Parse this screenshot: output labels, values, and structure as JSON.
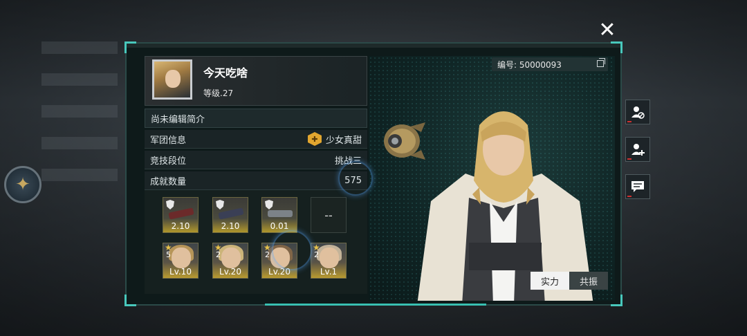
{
  "close_icon": "close-x-icon",
  "profile": {
    "name": "今天吃啥",
    "level": "等级.27"
  },
  "info_rows": [
    {
      "label": "尚未编辑简介",
      "value": ""
    },
    {
      "label": "军团信息",
      "value": "少女真甜"
    },
    {
      "label": "竞技段位",
      "value": "挑战三"
    },
    {
      "label": "成就数量",
      "value": "575"
    }
  ],
  "equipment": [
    {
      "value": "2.10",
      "icon": "shield-badge-icon"
    },
    {
      "value": "2.10",
      "icon": "rank-badge-icon"
    },
    {
      "value": "0.01",
      "icon": "shield-badge-icon"
    },
    {
      "value": "--",
      "icon": "empty-slot"
    }
  ],
  "heroes": [
    {
      "stars": "5",
      "level": "Lv.10"
    },
    {
      "stars": "2",
      "level": "Lv.20"
    },
    {
      "stars": "2",
      "level": "Lv.20"
    },
    {
      "stars": "2",
      "level": "Lv.1"
    }
  ],
  "player_id": "编号: 50000093",
  "toggle": {
    "strength_label": "实力",
    "resonance_label": "共振"
  },
  "side_buttons": [
    "block-user-icon",
    "add-friend-icon",
    "chat-message-icon"
  ],
  "colors": {
    "accent": "#3ee0d0",
    "gold": "#b89a30",
    "panel_bg": "#0e1a1a"
  }
}
